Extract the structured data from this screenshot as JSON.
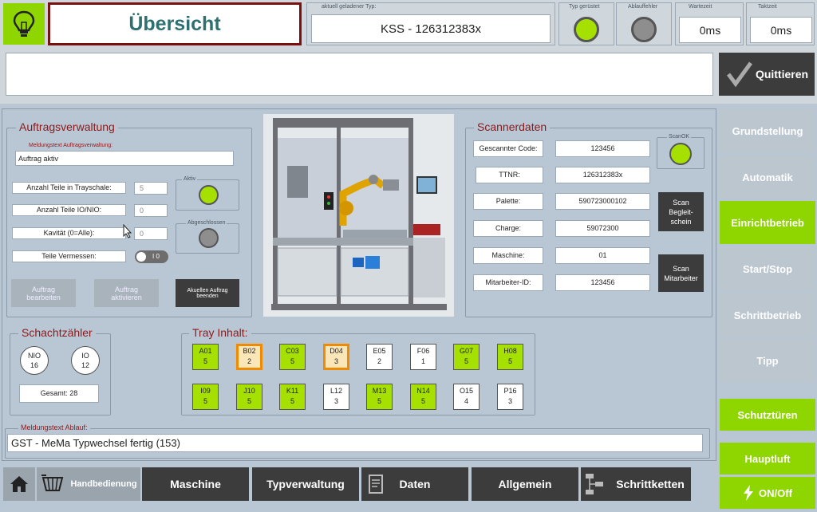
{
  "header": {
    "title": "Übersicht",
    "loaded_type_label": "aktuell geladener Typ:",
    "loaded_type_value": "KSS - 126312383x",
    "typ_geruestet_label": "Typ gerüstet",
    "ablauffehler_label": "Ablauffehler",
    "wartezeit_label": "Wartezeit",
    "wartezeit_value": "0ms",
    "taktzeit_label": "Taktzeit",
    "taktzeit_value": "0ms",
    "quittieren_label": "Quittieren"
  },
  "auftrag": {
    "legend": "Auftragsverwaltung",
    "meldung_label": "Meldungstext Auftragsverwaltung:",
    "meldung_value": "Auftrag aktiv",
    "rows": [
      {
        "label": "Anzahl Teile in Trayschale:",
        "value": "5"
      },
      {
        "label": "Anzahl Teile IO/NIO:",
        "value": "0"
      },
      {
        "label": "Kavität (0=Alle):",
        "value": "0"
      },
      {
        "label": "Teile Vermessen:",
        "value": ""
      }
    ],
    "toggle_text": "I  0",
    "aktiv_label": "Aktiv",
    "abgeschlossen_label": "Abgeschlossen",
    "btn_bearbeiten": "Auftrag bearbeiten",
    "btn_aktivieren": "Auftrag aktivieren",
    "btn_beenden": "Akuellen Auftrag beenden"
  },
  "scanner": {
    "legend": "Scannerdaten",
    "rows": [
      {
        "label": "Gescannter Code:",
        "value": "123456"
      },
      {
        "label": "TTNR:",
        "value": "126312383x"
      },
      {
        "label": "Palette:",
        "value": "590723000102"
      },
      {
        "label": "Charge:",
        "value": "59072300"
      },
      {
        "label": "Maschine:",
        "value": "01"
      },
      {
        "label": "Mitarbeiter-ID:",
        "value": "123456"
      }
    ],
    "scanok_label": "ScanOK",
    "btn_begleitschein": "Scan Begleit- schein",
    "btn_mitarbeiter": "Scan Mitarbeiter"
  },
  "schacht": {
    "legend": "Schachtzähler",
    "nio_label": "NIO",
    "nio_value": "16",
    "io_label": "IO",
    "io_value": "12",
    "gesamt": "Gesamt: 28"
  },
  "tray": {
    "legend": "Tray Inhalt:",
    "cells": [
      {
        "id": "A01",
        "n": "5",
        "s": "g"
      },
      {
        "id": "B02",
        "n": "2",
        "s": "o"
      },
      {
        "id": "C03",
        "n": "5",
        "s": "g"
      },
      {
        "id": "D04",
        "n": "3",
        "s": "o"
      },
      {
        "id": "E05",
        "n": "2",
        "s": "w"
      },
      {
        "id": "F06",
        "n": "1",
        "s": "w"
      },
      {
        "id": "G07",
        "n": "5",
        "s": "g"
      },
      {
        "id": "H08",
        "n": "5",
        "s": "g"
      },
      {
        "id": "I09",
        "n": "5",
        "s": "g"
      },
      {
        "id": "J10",
        "n": "5",
        "s": "g"
      },
      {
        "id": "K11",
        "n": "5",
        "s": "g"
      },
      {
        "id": "L12",
        "n": "3",
        "s": "w"
      },
      {
        "id": "M13",
        "n": "5",
        "s": "g"
      },
      {
        "id": "N14",
        "n": "5",
        "s": "g"
      },
      {
        "id": "O15",
        "n": "4",
        "s": "w"
      },
      {
        "id": "P16",
        "n": "3",
        "s": "w"
      }
    ]
  },
  "ablauf": {
    "label": "Meldungstext Ablauf:",
    "value": "GST - MeMa Typwechsel fertig (153)"
  },
  "sidebar": {
    "items": [
      "Grundstellung",
      "Automatik",
      "Einrichtbetrieb",
      "Start/Stop",
      "Schrittbetrieb",
      "Tipp"
    ],
    "schutztueren": "Schutztüren",
    "hauptluft": "Hauptluft",
    "onoff": "ON/Off"
  },
  "nav": {
    "handbedienung": "Handbedienung",
    "maschine": "Maschine",
    "typverwaltung": "Typverwaltung",
    "daten": "Daten",
    "allgemein": "Allgemein",
    "schrittketten": "Schrittketten"
  },
  "colors": {
    "green": "#a6e000",
    "dark_button": "#3c3c3c",
    "title_border": "#7a1010"
  }
}
